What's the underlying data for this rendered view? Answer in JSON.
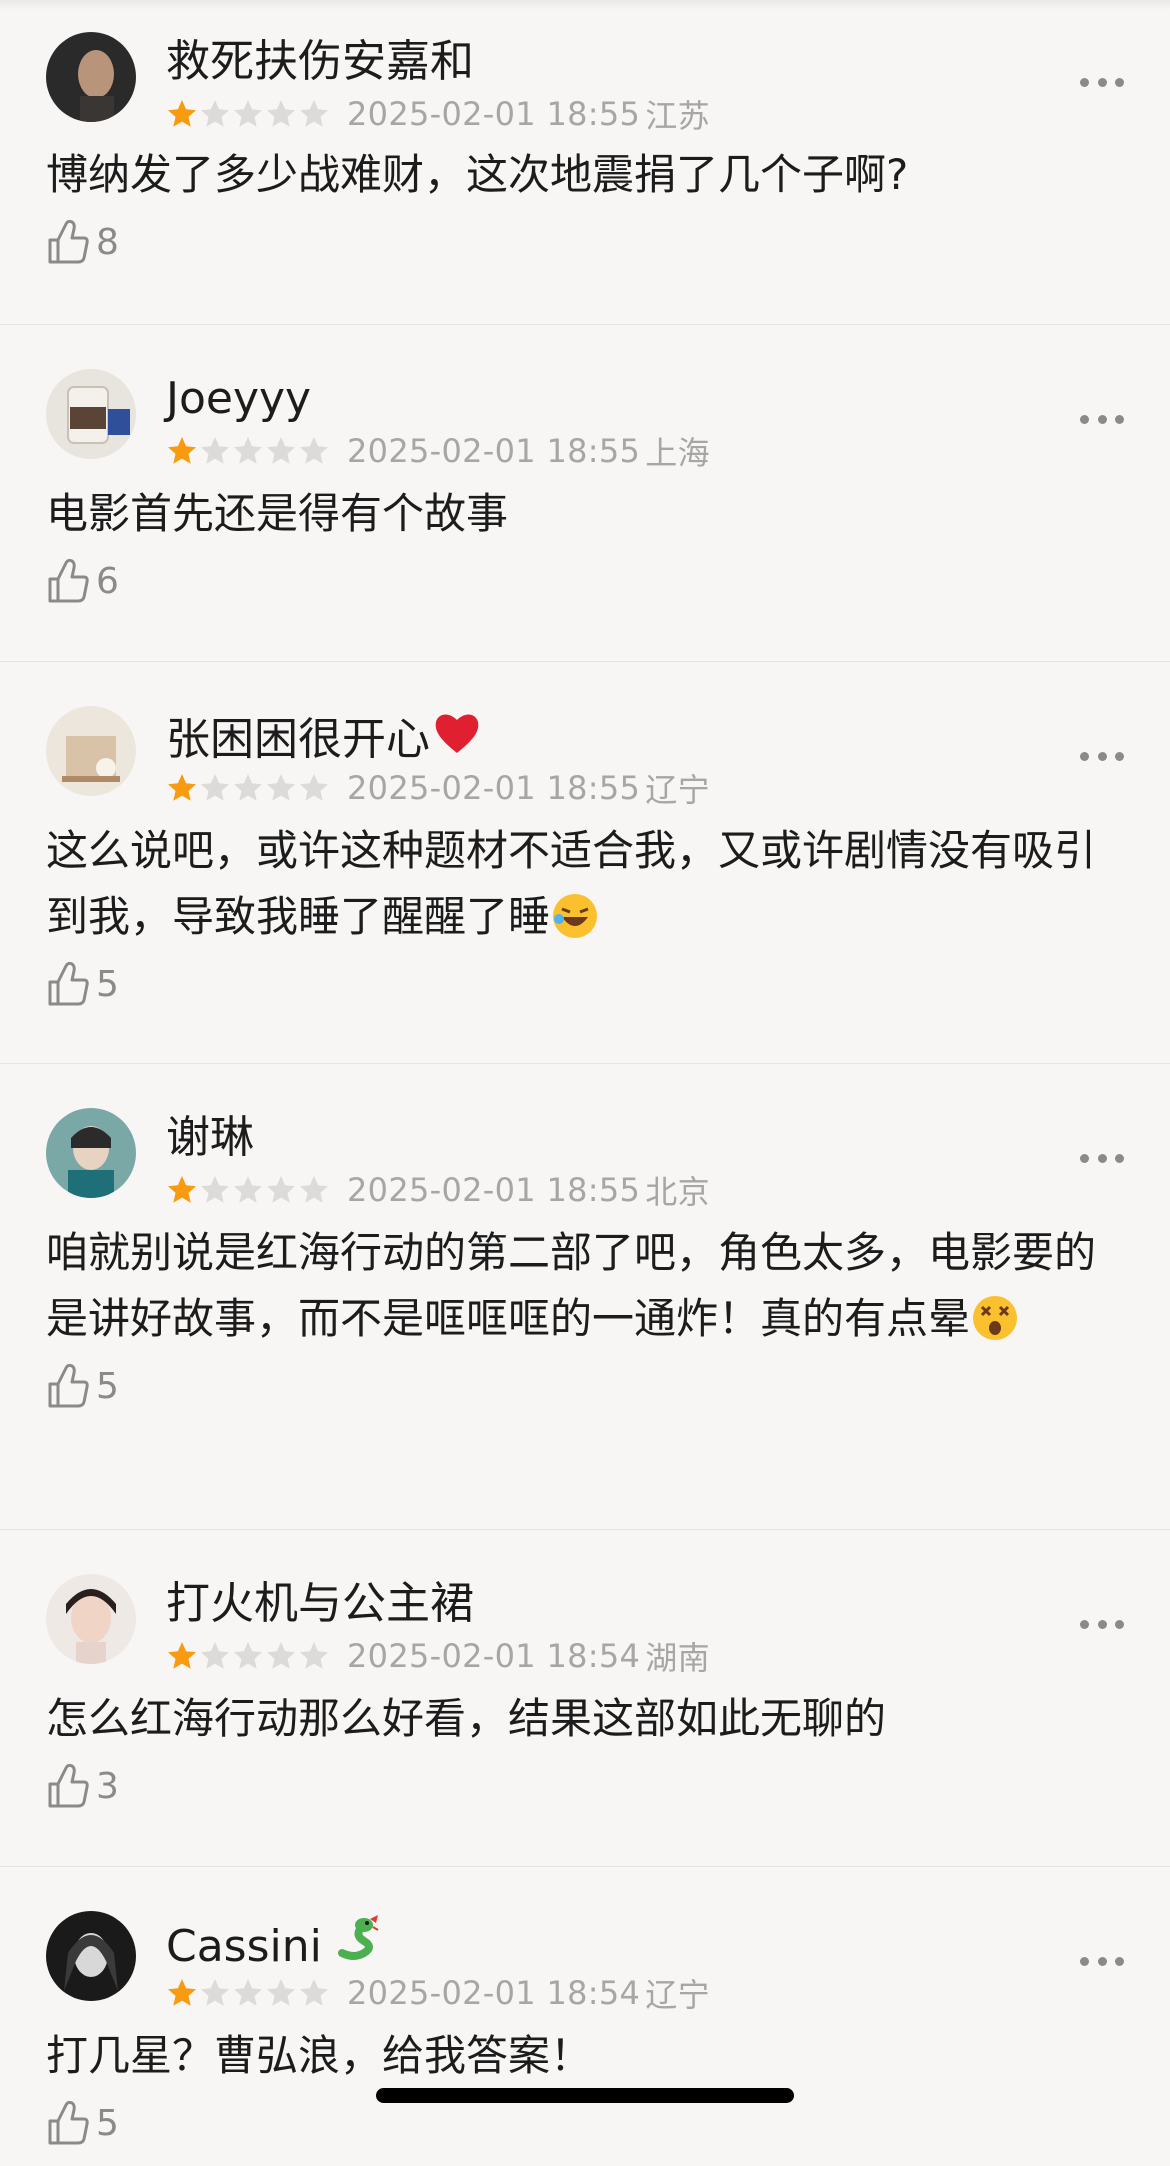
{
  "colors": {
    "star_filled": "#f99b10",
    "star_empty": "#dcdbd9",
    "meta": "#a8a6a4",
    "accent_heart": "#e02030"
  },
  "reviews": [
    {
      "name": "救死扶伤安嘉和",
      "stars": 1,
      "date": "2025-02-01 18:55",
      "location": "江苏",
      "text": "博纳发了多少战难财，这次地震捐了几个子啊?",
      "likes": "8"
    },
    {
      "name": "Joeyyy",
      "stars": 1,
      "date": "2025-02-01 18:55",
      "location": "上海",
      "text": "电影首先还是得有个故事",
      "likes": "6"
    },
    {
      "name": "张困困很开心",
      "stars": 1,
      "date": "2025-02-01 18:55",
      "location": "辽宁",
      "text": "这么说吧，或许这种题材不适合我，又或许剧情没有吸引到我，导致我睡了醒醒了睡",
      "likes": "5",
      "name_emoji": "heart-emoji",
      "text_emoji": "laughing-emoji"
    },
    {
      "name": "谢琳",
      "stars": 1,
      "date": "2025-02-01 18:55",
      "location": "北京",
      "text": "咱就别说是红海行动的第二部了吧，角色太多，电影要的是讲好故事，而不是哐哐哐的一通炸！真的有点晕",
      "likes": "5",
      "text_emoji": "dizzy-face-emoji"
    },
    {
      "name": "打火机与公主裙",
      "stars": 1,
      "date": "2025-02-01 18:54",
      "location": "湖南",
      "text": "怎么红海行动那么好看，结果这部如此无聊的",
      "likes": "3"
    },
    {
      "name": "Cassini",
      "stars": 1,
      "date": "2025-02-01 18:54",
      "location": "辽宁",
      "text": "打几星？曹弘浪，给我答案！",
      "likes": "5",
      "name_emoji": "snake-emoji"
    }
  ]
}
